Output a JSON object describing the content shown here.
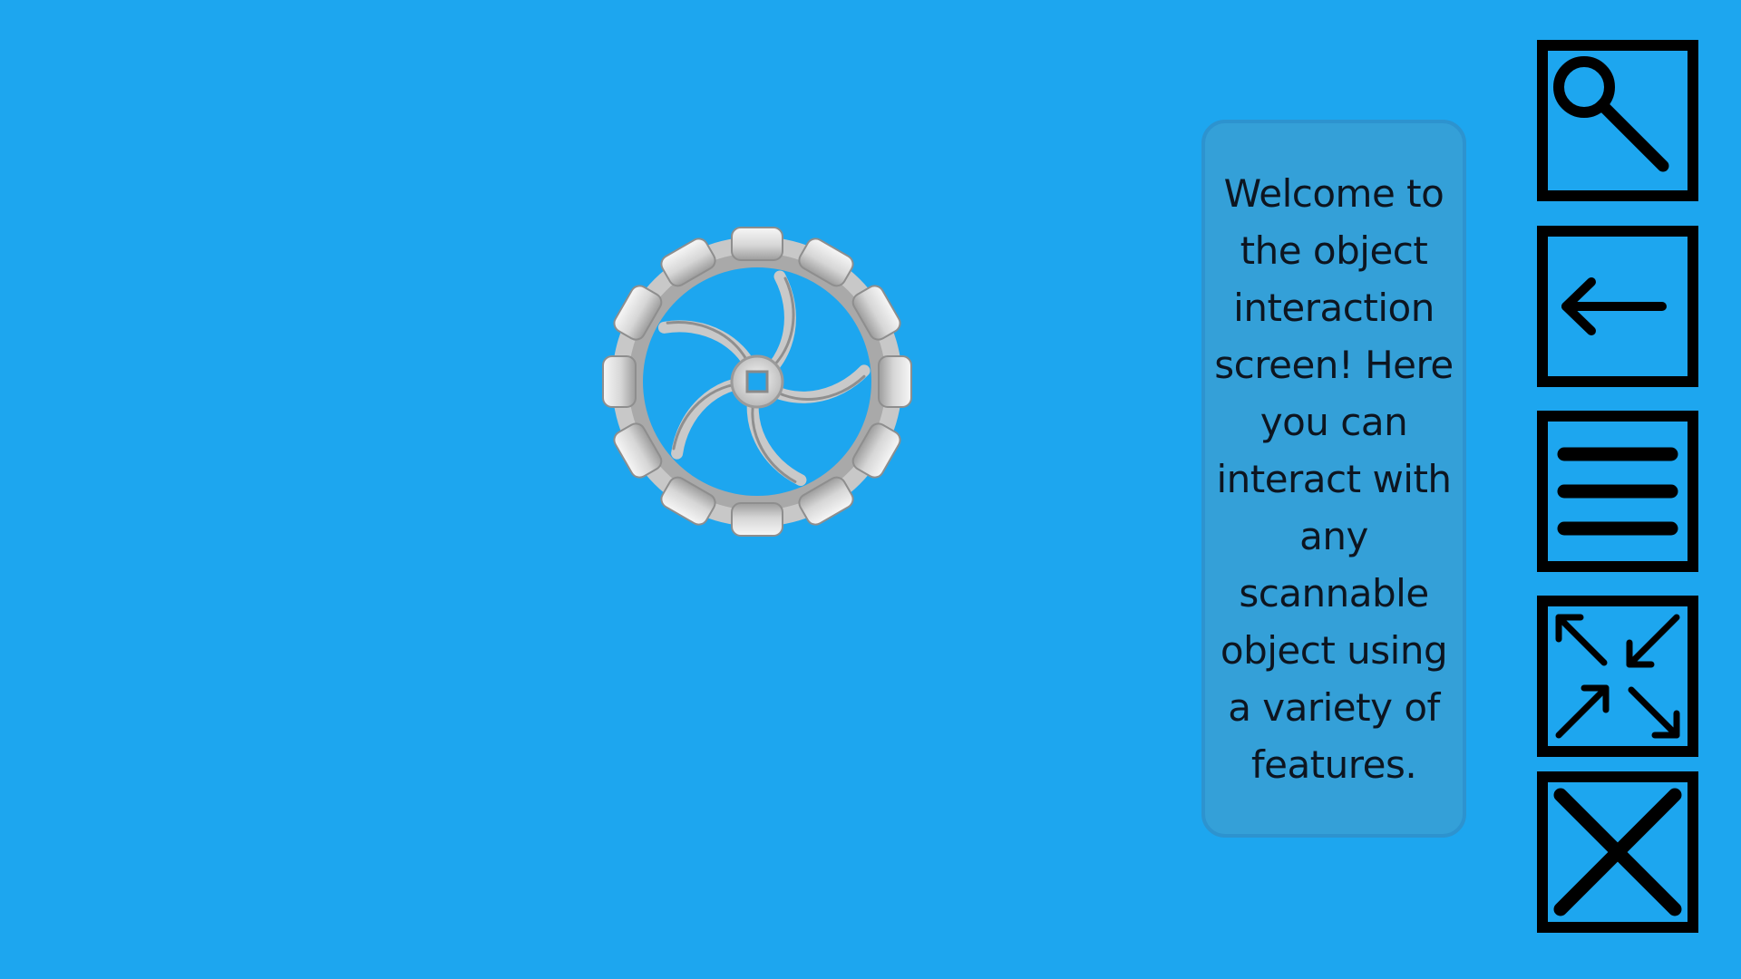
{
  "screen": {
    "background_color": "#1da6ef",
    "panel_color": "#34a0d8"
  },
  "object": {
    "icon": "mecanum-wheel-icon"
  },
  "info_panel": {
    "text": "Welcome to the object interaction screen! Here you can interact with any scannable object using a variety of features."
  },
  "toolbar": {
    "buttons": [
      {
        "icon": "magnifier-icon"
      },
      {
        "icon": "back-arrow-icon"
      },
      {
        "icon": "menu-icon"
      },
      {
        "icon": "collapse-arrows-icon"
      },
      {
        "icon": "close-icon"
      }
    ]
  }
}
